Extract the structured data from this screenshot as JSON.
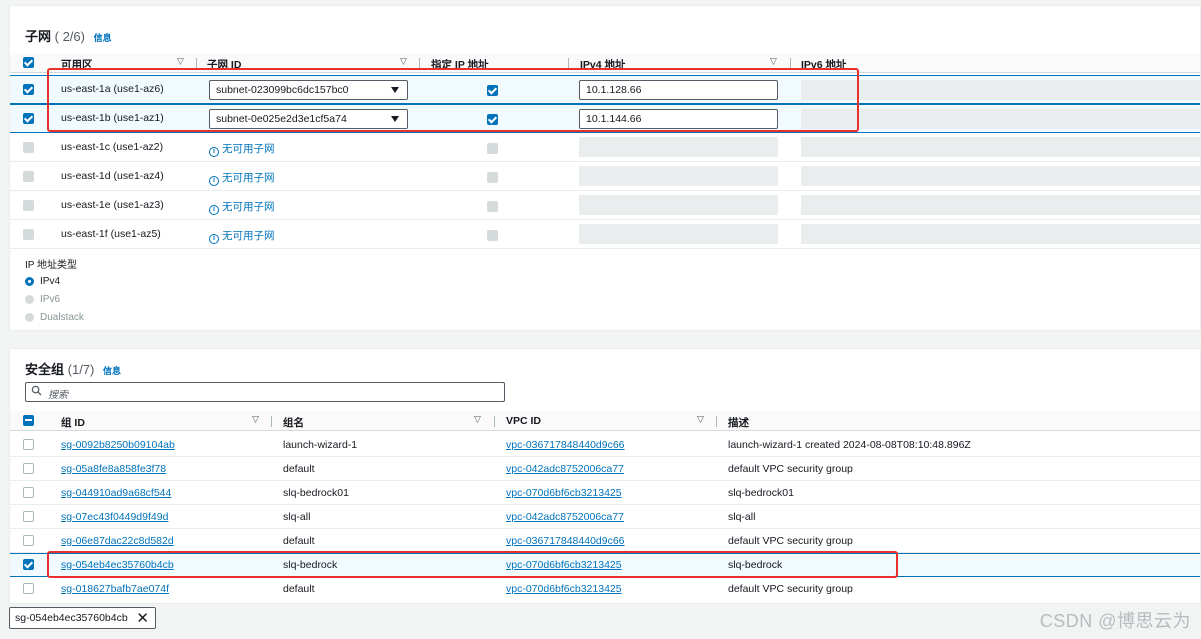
{
  "subnets": {
    "title": "子网",
    "count": "( 2/6)",
    "info": "信息",
    "columns": [
      "可用区",
      "子网 ID",
      "指定 IP 地址",
      "IPv4 地址",
      "IPv6 地址"
    ],
    "rows": [
      {
        "az": "us-east-1a (use1-az6)",
        "subnet": "subnet-023099bc6dc157bc0",
        "ipv4": "10.1.128.66"
      },
      {
        "az": "us-east-1b (use1-az1)",
        "subnet": "subnet-0e025e2d3e1cf5a74",
        "ipv4": "10.1.144.66"
      },
      {
        "az": "us-east-1c (use1-az2)",
        "none": "无可用子网"
      },
      {
        "az": "us-east-1d (use1-az4)",
        "none": "无可用子网"
      },
      {
        "az": "us-east-1e (use1-az3)",
        "none": "无可用子网"
      },
      {
        "az": "us-east-1f (use1-az5)",
        "none": "无可用子网"
      }
    ],
    "ip_type_label": "IP 地址类型",
    "ip_types": [
      "IPv4",
      "IPv6",
      "Dualstack"
    ],
    "ip_type_selected": "IPv4"
  },
  "security_groups": {
    "title": "安全组",
    "count": "(1/7)",
    "info": "信息",
    "search_placeholder": "搜索",
    "columns": [
      "组 ID",
      "组名",
      "VPC ID",
      "描述"
    ],
    "rows": [
      {
        "id": "sg-0092b8250b09104ab",
        "name": "launch-wizard-1",
        "vpc": "vpc-036717848440d9c66",
        "desc": "launch-wizard-1 created 2024-08-08T08:10:48.896Z"
      },
      {
        "id": "sg-05a8fe8a858fe3f78",
        "name": "default",
        "vpc": "vpc-042adc8752006ca77",
        "desc": "default VPC security group"
      },
      {
        "id": "sg-044910ad9a68cf544",
        "name": "slq-bedrock01",
        "vpc": "vpc-070d6bf6cb3213425",
        "desc": "slq-bedrock01"
      },
      {
        "id": "sg-07ec43f0449d9f49d",
        "name": "slq-all",
        "vpc": "vpc-042adc8752006ca77",
        "desc": "slq-all"
      },
      {
        "id": "sg-06e87dac22c8d582d",
        "name": "default",
        "vpc": "vpc-036717848440d9c66",
        "desc": "default VPC security group"
      },
      {
        "id": "sg-054eb4ec35760b4cb",
        "name": "slq-bedrock",
        "vpc": "vpc-070d6bf6cb3213425",
        "desc": "slq-bedrock"
      },
      {
        "id": "sg-018627bafb7ae074f",
        "name": "default",
        "vpc": "vpc-070d6bf6cb3213425",
        "desc": "default VPC security group"
      }
    ],
    "selected_token": "sg-054eb4ec35760b4cb"
  },
  "watermark": "CSDN @博思云为",
  "colors": {
    "accent": "#0073bb",
    "highlight": "#e8312f"
  }
}
